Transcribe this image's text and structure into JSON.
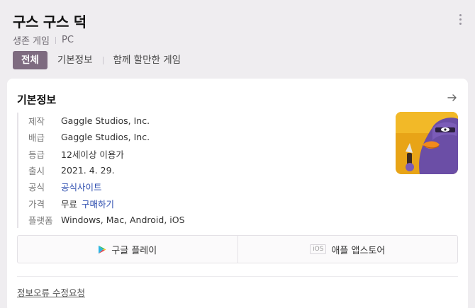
{
  "header": {
    "title": "구스 구스 덕",
    "genre": "생존 게임",
    "platform": "PC"
  },
  "tabs": [
    {
      "label": "전체",
      "active": true
    },
    {
      "label": "기본정보",
      "active": false
    },
    {
      "label": "함께 할만한 게임",
      "active": false
    }
  ],
  "card": {
    "title": "기본정보",
    "rows": {
      "developer": {
        "key": "제작",
        "value": "Gaggle Studios, Inc."
      },
      "publisher": {
        "key": "배급",
        "value": "Gaggle Studios, Inc."
      },
      "rating": {
        "key": "등급",
        "value": "12세이상 이용가"
      },
      "release": {
        "key": "출시",
        "value": "2021. 4. 29."
      },
      "official": {
        "key": "공식",
        "value": "공식사이트"
      },
      "price": {
        "key": "가격",
        "value": "무료",
        "link": "구매하기"
      },
      "platforms": {
        "key": "플랫폼",
        "value": "Windows, Mac, Android, iOS"
      }
    },
    "stores": {
      "google": "구글 플레이",
      "ios_badge": "iOS",
      "apple": "애플 앱스토어"
    },
    "report": "정보오류 수정요청"
  },
  "colors": {
    "active_tab": "#7e6b80",
    "link": "#2f4fb0",
    "thumb_bg": "#e8a417",
    "goose": "#6b4ea6"
  }
}
